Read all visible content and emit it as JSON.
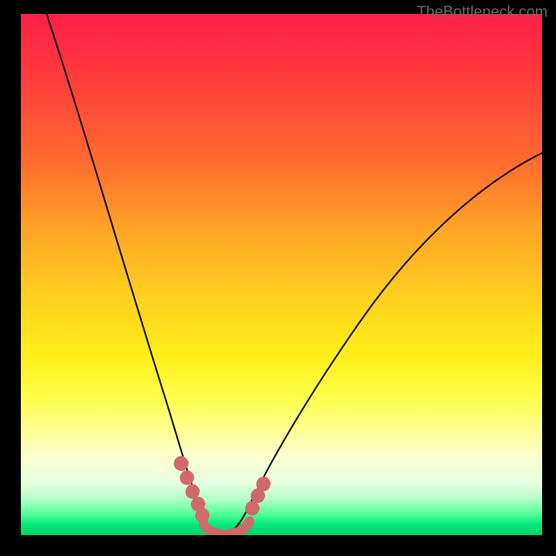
{
  "watermark_text": "TheBottleneck.com",
  "chart_data": {
    "type": "line",
    "title": "",
    "xlabel": "",
    "ylabel": "",
    "xlim": [
      0,
      100
    ],
    "ylim": [
      0,
      100
    ],
    "series": [
      {
        "name": "bottleneck-curve",
        "x": [
          5,
          10,
          15,
          20,
          25,
          28,
          30,
          32,
          34,
          36,
          38,
          40,
          45,
          50,
          55,
          60,
          65,
          70,
          75,
          80,
          85,
          90,
          95,
          100
        ],
        "y": [
          100,
          84,
          68,
          52,
          34,
          22,
          14,
          7,
          2,
          0,
          0,
          2,
          12,
          23,
          33,
          41,
          48,
          53,
          58,
          62,
          65,
          68,
          70,
          72
        ]
      },
      {
        "name": "highlight-band",
        "x": [
          28,
          30,
          32,
          34,
          36,
          38,
          40,
          42
        ],
        "y": [
          15,
          8,
          3,
          1,
          0,
          1,
          3,
          8
        ]
      }
    ],
    "annotations": [],
    "legend": false
  },
  "colors": {
    "curve": "#000000",
    "highlight": "#d46a6a",
    "gradient_top": "#ff1f47",
    "gradient_bottom": "#00d468"
  }
}
